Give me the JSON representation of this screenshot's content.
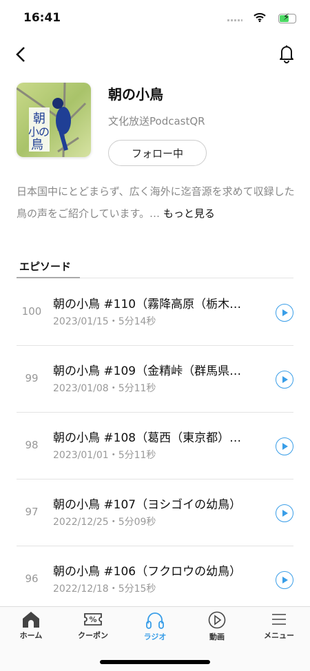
{
  "status": {
    "time": "16:41"
  },
  "podcast": {
    "title": "朝の小鳥",
    "author": "文化放送PodcastQR",
    "follow_label": "フォロー中",
    "artwork_text": "朝の小鳥",
    "description": "日本国中にとどまらず、広く海外に迄音源を求めて収録した鳥の声をご紹介しています。…",
    "more_label": "もっと見る"
  },
  "tab": {
    "label": "エピソード"
  },
  "episodes": [
    {
      "num": "100",
      "title": "朝の小鳥 #110（霧降高原（栃木…",
      "meta": "2023/01/15・5分14秒"
    },
    {
      "num": "99",
      "title": "朝の小鳥 #109（金精峠（群馬県…",
      "meta": "2023/01/08・5分11秒"
    },
    {
      "num": "98",
      "title": "朝の小鳥 #108（葛西（東京都）…",
      "meta": "2023/01/01・5分11秒"
    },
    {
      "num": "97",
      "title": "朝の小鳥 #107（ヨシゴイの幼鳥）",
      "meta": "2022/12/25・5分09秒"
    },
    {
      "num": "96",
      "title": "朝の小鳥 #106（フクロウの幼鳥）",
      "meta": "2022/12/18・5分15秒"
    }
  ],
  "tabbar": {
    "active": "ラジオ",
    "accent": "#3a9ee8",
    "items": [
      {
        "label": "ホーム",
        "icon": "home-icon"
      },
      {
        "label": "クーポン",
        "icon": "coupon-icon"
      },
      {
        "label": "ラジオ",
        "icon": "headphones-icon"
      },
      {
        "label": "動画",
        "icon": "play-circle-icon"
      },
      {
        "label": "メニュー",
        "icon": "menu-icon"
      }
    ]
  }
}
